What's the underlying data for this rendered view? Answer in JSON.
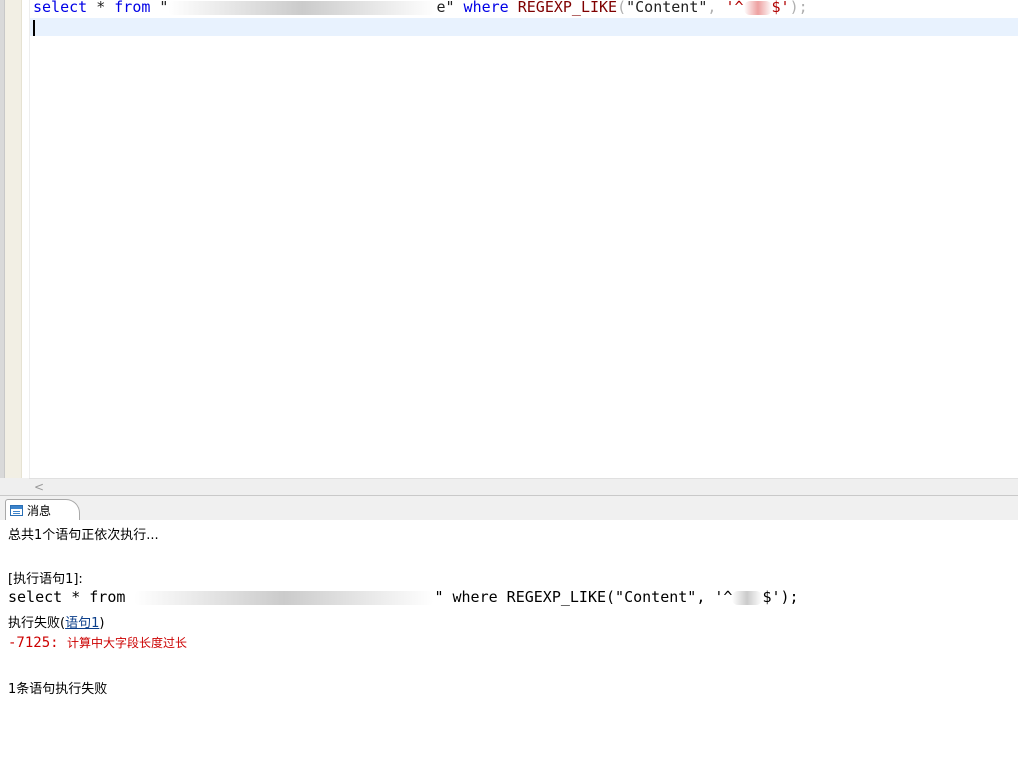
{
  "editor": {
    "line1": {
      "select": "select",
      "star": " * ",
      "from": "from",
      "quote_open": " \"",
      "table_tail": "e\"",
      "where": " where ",
      "fn": "REGEXP_LIKE",
      "paren_open": "(",
      "arg1": "\"Content\"",
      "comma": ", ",
      "str_start": "'^",
      "str_end": "$'",
      "paren_close": ");"
    }
  },
  "panel": {
    "tab_label": "消息",
    "total": "总共1个语句正依次执行...",
    "head": "[执行语句1]:",
    "sql": {
      "select": "select * from ",
      "mid": "\" where REGEXP_LIKE(\"Content\", '^",
      "end": "$');"
    },
    "fail_prefix": "执行失败(",
    "fail_link": "语句1",
    "fail_suffix": ")",
    "error_code": "-7125: ",
    "error_text": "计算中大字段长度过长",
    "summary": "1条语句执行失败"
  },
  "scrollbar": {
    "left_arrow": "<"
  }
}
